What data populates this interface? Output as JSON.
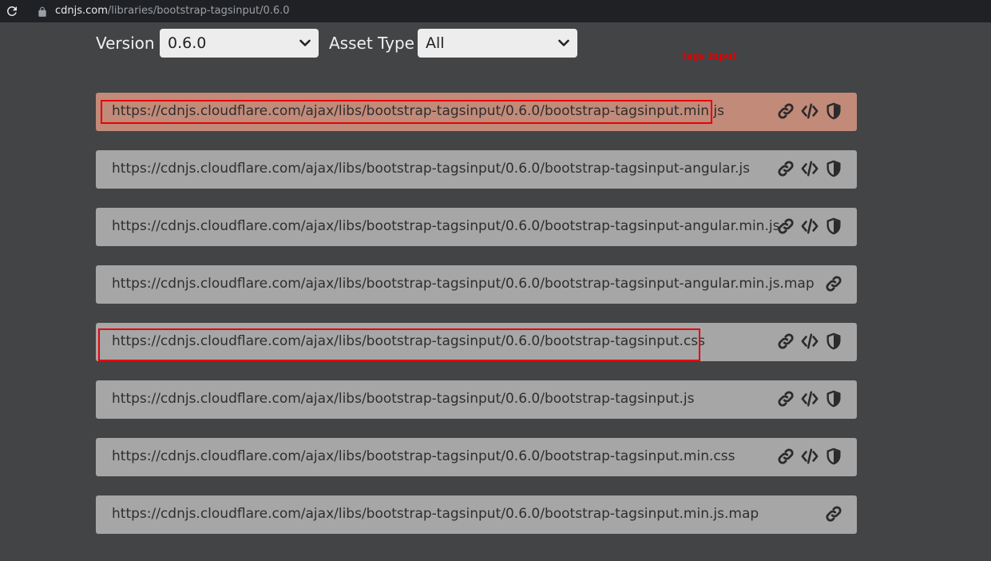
{
  "browser": {
    "url_domain": "cdnjs.com",
    "url_path": "/libraries/bootstrap-tagsinput/0.6.0"
  },
  "filters": {
    "version_label": "Version",
    "version_value": "0.6.0",
    "asset_type_label": "Asset Type",
    "asset_type_value": "All"
  },
  "annotation_text": "tags input",
  "colors": {
    "background": "#434446",
    "row": "#a6a6a6",
    "row_highlight": "#c28a79",
    "annotation_red": "#e8000b"
  },
  "assets": [
    {
      "url": "https://cdnjs.cloudflare.com/ajax/libs/bootstrap-tagsinput/0.6.0/bootstrap-tagsinput.min.js",
      "icons": [
        "link-icon",
        "code-icon",
        "shield-icon"
      ],
      "highlighted": true,
      "boxed": true
    },
    {
      "url": "https://cdnjs.cloudflare.com/ajax/libs/bootstrap-tagsinput/0.6.0/bootstrap-tagsinput-angular.js",
      "icons": [
        "link-icon",
        "code-icon",
        "shield-icon"
      ],
      "highlighted": false,
      "boxed": false
    },
    {
      "url": "https://cdnjs.cloudflare.com/ajax/libs/bootstrap-tagsinput/0.6.0/bootstrap-tagsinput-angular.min.js",
      "icons": [
        "link-icon",
        "code-icon",
        "shield-icon"
      ],
      "highlighted": false,
      "boxed": false
    },
    {
      "url": "https://cdnjs.cloudflare.com/ajax/libs/bootstrap-tagsinput/0.6.0/bootstrap-tagsinput-angular.min.js.map",
      "icons": [
        "link-icon"
      ],
      "highlighted": false,
      "boxed": false
    },
    {
      "url": "https://cdnjs.cloudflare.com/ajax/libs/bootstrap-tagsinput/0.6.0/bootstrap-tagsinput.css",
      "icons": [
        "link-icon",
        "code-icon",
        "shield-icon"
      ],
      "highlighted": false,
      "boxed": true
    },
    {
      "url": "https://cdnjs.cloudflare.com/ajax/libs/bootstrap-tagsinput/0.6.0/bootstrap-tagsinput.js",
      "icons": [
        "link-icon",
        "code-icon",
        "shield-icon"
      ],
      "highlighted": false,
      "boxed": false
    },
    {
      "url": "https://cdnjs.cloudflare.com/ajax/libs/bootstrap-tagsinput/0.6.0/bootstrap-tagsinput.min.css",
      "icons": [
        "link-icon",
        "code-icon",
        "shield-icon"
      ],
      "highlighted": false,
      "boxed": false
    },
    {
      "url": "https://cdnjs.cloudflare.com/ajax/libs/bootstrap-tagsinput/0.6.0/bootstrap-tagsinput.min.js.map",
      "icons": [
        "link-icon"
      ],
      "highlighted": false,
      "boxed": false
    }
  ]
}
